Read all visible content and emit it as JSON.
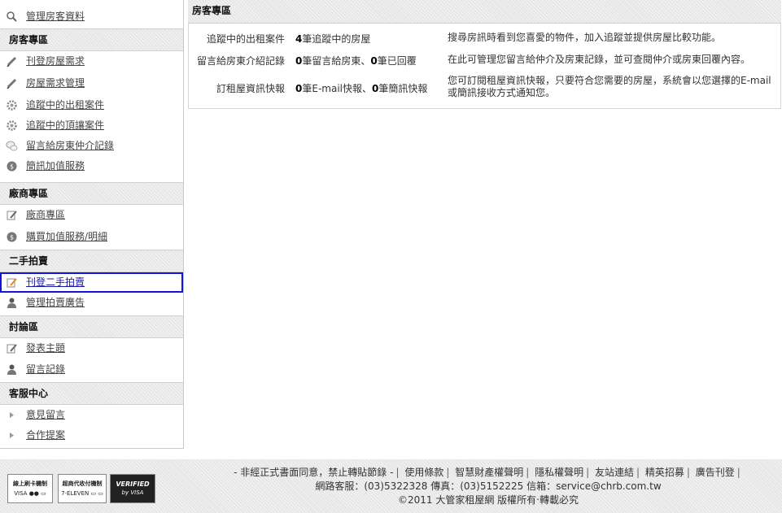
{
  "sidebar": {
    "top_item": {
      "label": "管理房客資料",
      "icon": "magnifier-settings-icon"
    },
    "sections": [
      {
        "title": "房客專區",
        "items": [
          {
            "label": "刊登房屋需求",
            "icon": "pencil-icon"
          },
          {
            "label": "房屋需求管理",
            "icon": "pencil-icon"
          },
          {
            "label": "追蹤中的出租案件",
            "icon": "gear-icon"
          },
          {
            "label": "追蹤中的頂讓案件",
            "icon": "gear-icon"
          },
          {
            "label": "留言給房東仲介記錄",
            "icon": "speech-bubble-icon"
          },
          {
            "label": "簡訊加值服務",
            "icon": "coin-icon"
          }
        ]
      },
      {
        "title": "廠商專區",
        "items": [
          {
            "label": "廠商專區",
            "icon": "edit-document-icon"
          },
          {
            "label": "購買加值服務/明細",
            "icon": "coin-icon"
          }
        ]
      },
      {
        "title": "二手拍賣",
        "items": [
          {
            "label": "刊登二手拍賣",
            "icon": "edit-document-icon",
            "highlighted": true
          },
          {
            "label": "管理拍賣廣告",
            "icon": "user-icon"
          }
        ]
      },
      {
        "title": "討論區",
        "items": [
          {
            "label": "發表主題",
            "icon": "edit-document-icon"
          },
          {
            "label": "留言記錄",
            "icon": "user-icon"
          }
        ]
      },
      {
        "title": "客服中心",
        "items": [
          {
            "label": "意見留言",
            "icon": "arrow-right-icon"
          },
          {
            "label": "合作提案",
            "icon": "arrow-right-icon"
          }
        ]
      }
    ]
  },
  "main": {
    "title": "房客專區",
    "rows": [
      {
        "label": "追蹤中的出租案件",
        "stat_num": "4",
        "stat_text": "筆追蹤中的房屋",
        "desc": "搜尋房訊時看到您喜愛的物件，加入追蹤並提供房屋比較功能。"
      },
      {
        "label": "留言給房東介紹記錄",
        "stat_num": "0",
        "stat_text": "筆留言給房東、",
        "stat_num2": "0",
        "stat_text2": "筆已回覆",
        "desc": "在此可管理您留言給仲介及房東記錄，並可查閱仲介或房東回覆內容。"
      },
      {
        "label": "訂租屋資訊快報",
        "stat_num": "0",
        "stat_text": "筆E-mail快報、",
        "stat_num2": "0",
        "stat_text2": "筆簡訊快報",
        "desc": "您可訂閱租屋資訊快報，只要符合您需要的房屋，系統會以您選擇的E-mail或簡訊接收方式通知您。"
      }
    ]
  },
  "footer": {
    "prefix": "- 非經正式書面同意，禁止轉貼節錄 -",
    "links": [
      "使用條款",
      "智慧財產權聲明",
      "隱私權聲明",
      "友站連結",
      "精英招募",
      "廣告刊登"
    ],
    "contact": "網路客服：(03)5322328 傳真：(03)5152225 信箱：service@chrb.com.tw",
    "copyright": "©2011 大管家租屋網 版權所有‧轉載必究",
    "badges": [
      {
        "line1": "線上刷卡機制",
        "line2": "VISA ●● ▭"
      },
      {
        "line1": "超商代收付機制",
        "line2": "7-ELEVEN ▭ ▭"
      },
      {
        "line1": "VERIFIED",
        "line2": "by VISA"
      }
    ]
  },
  "colors": {
    "highlight_border": "#1414d6",
    "section_bg": "#e6e6e6"
  }
}
